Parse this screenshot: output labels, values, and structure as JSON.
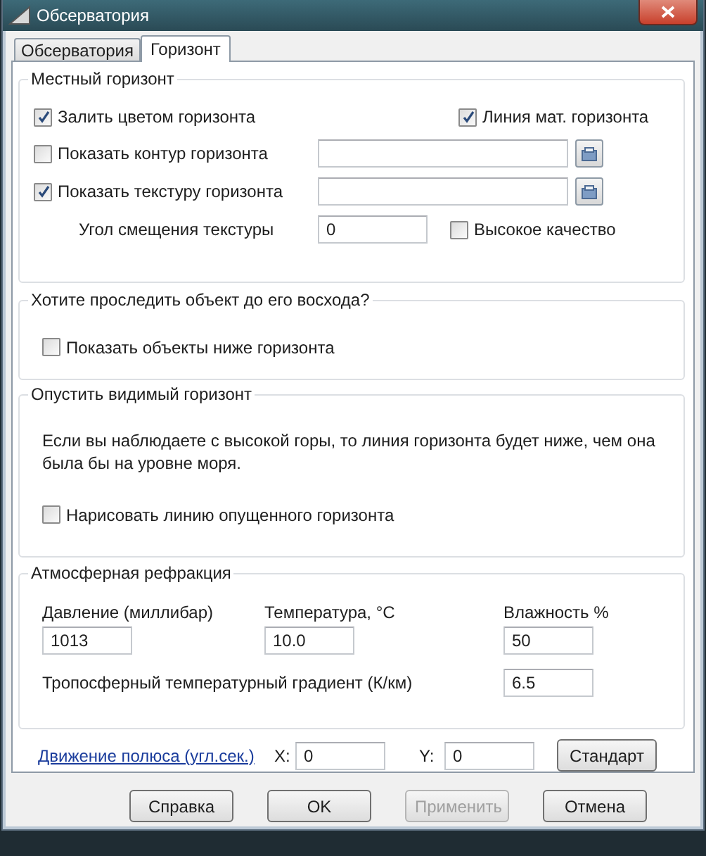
{
  "window": {
    "title": "Обсерватория"
  },
  "tabs": [
    {
      "label": "Обсерватория",
      "selected": false
    },
    {
      "label": "Горизонт",
      "selected": true
    }
  ],
  "local_horizon": {
    "title": "Местный горизонт",
    "fill_color": {
      "label": "Залить цветом горизонта",
      "checked": true
    },
    "math_horizon_line": {
      "label": "Линия мат. горизонта",
      "checked": true
    },
    "show_outline": {
      "label": "Показать контур горизонта",
      "checked": false
    },
    "show_texture": {
      "label": "Показать текстуру горизонта",
      "checked": true
    },
    "texture_offset": {
      "label": "Угол смещения текстуры",
      "value": "0"
    },
    "high_quality": {
      "label": "Высокое качество",
      "checked": false
    }
  },
  "track_object": {
    "title": "Хотите проследить объект до его восхода?",
    "show_below": {
      "label": "Показать объекты ниже горизонта",
      "checked": false
    }
  },
  "lower_horizon": {
    "title": "Опустить видимый горизонт",
    "description": "Если вы наблюдаете с высокой горы, то линия горизонта будет ниже, чем она была бы на уровне моря.",
    "draw_line": {
      "label": "Нарисовать линию опущенного горизонта",
      "checked": false
    }
  },
  "refraction": {
    "title": "Атмосферная рефракция",
    "pressure": {
      "label": "Давление (миллибар)",
      "value": "1013"
    },
    "temperature": {
      "label": "Температура, °C",
      "value": "10.0"
    },
    "humidity": {
      "label": "Влажность %",
      "value": "50"
    },
    "gradient": {
      "label": "Тропосферный температурный градиент (К/км)",
      "value": "6.5"
    }
  },
  "polar_motion": {
    "link": "Движение полюса (угл.сек.)",
    "x_label": "X:",
    "x_value": "0",
    "y_label": "Y:",
    "y_value": "0",
    "default_button": "Стандарт"
  },
  "buttons": [
    {
      "label": "Справка",
      "disabled": false
    },
    {
      "label": "OK",
      "disabled": false
    },
    {
      "label": "Применить",
      "disabled": true
    },
    {
      "label": "Отмена",
      "disabled": false
    }
  ]
}
